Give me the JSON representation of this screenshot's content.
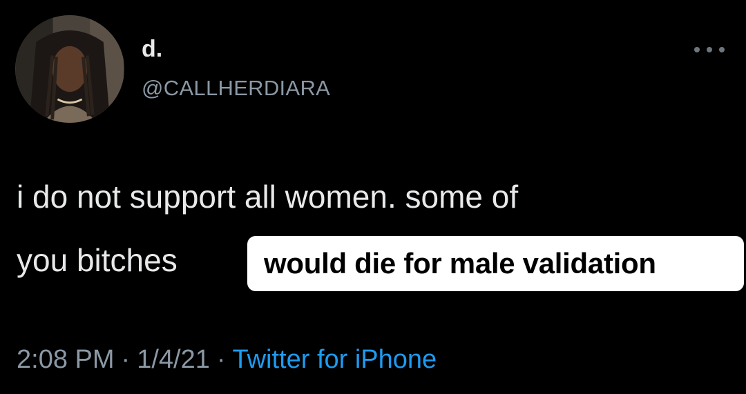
{
  "tweet": {
    "display_name": "d.",
    "handle": "@CALLHERDIARA",
    "avatar_icon": "profile-photo",
    "more_icon": "more-horizontal-icon",
    "text_line1": "i do not support all women. some of",
    "text_line2": "you bitches",
    "overlay_caption": "would die for male validation",
    "time": "2:08 PM",
    "separator": "·",
    "date": "1/4/21",
    "source": "Twitter for iPhone"
  },
  "colors": {
    "background": "#000000",
    "primary_text": "#e7e9ea",
    "secondary_text": "#8b98a5",
    "link": "#1d9bf0",
    "caption_bg": "#ffffff",
    "caption_text": "#000000"
  }
}
